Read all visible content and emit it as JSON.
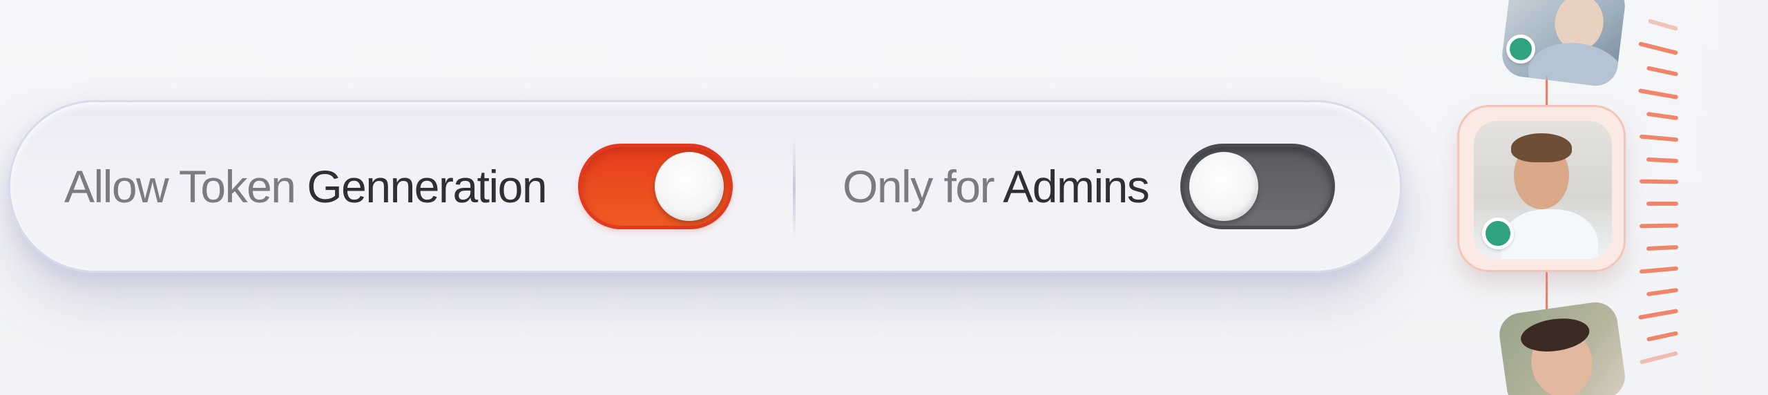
{
  "settings": [
    {
      "label_part1": "Allow Token ",
      "label_part2": "Genneration",
      "state": "on"
    },
    {
      "label_part1": "Only for ",
      "label_part2": "Admins",
      "state": "off"
    }
  ],
  "colors": {
    "toggle_on": "#e8461f",
    "toggle_off": "#606165",
    "status_online": "#2fa27f",
    "accent_ruler": "#f0856a"
  },
  "avatars": [
    {
      "icon": "user-avatar-top",
      "online": true
    },
    {
      "icon": "user-avatar-selected",
      "online": true
    },
    {
      "icon": "user-avatar-bottom",
      "online": false
    }
  ]
}
